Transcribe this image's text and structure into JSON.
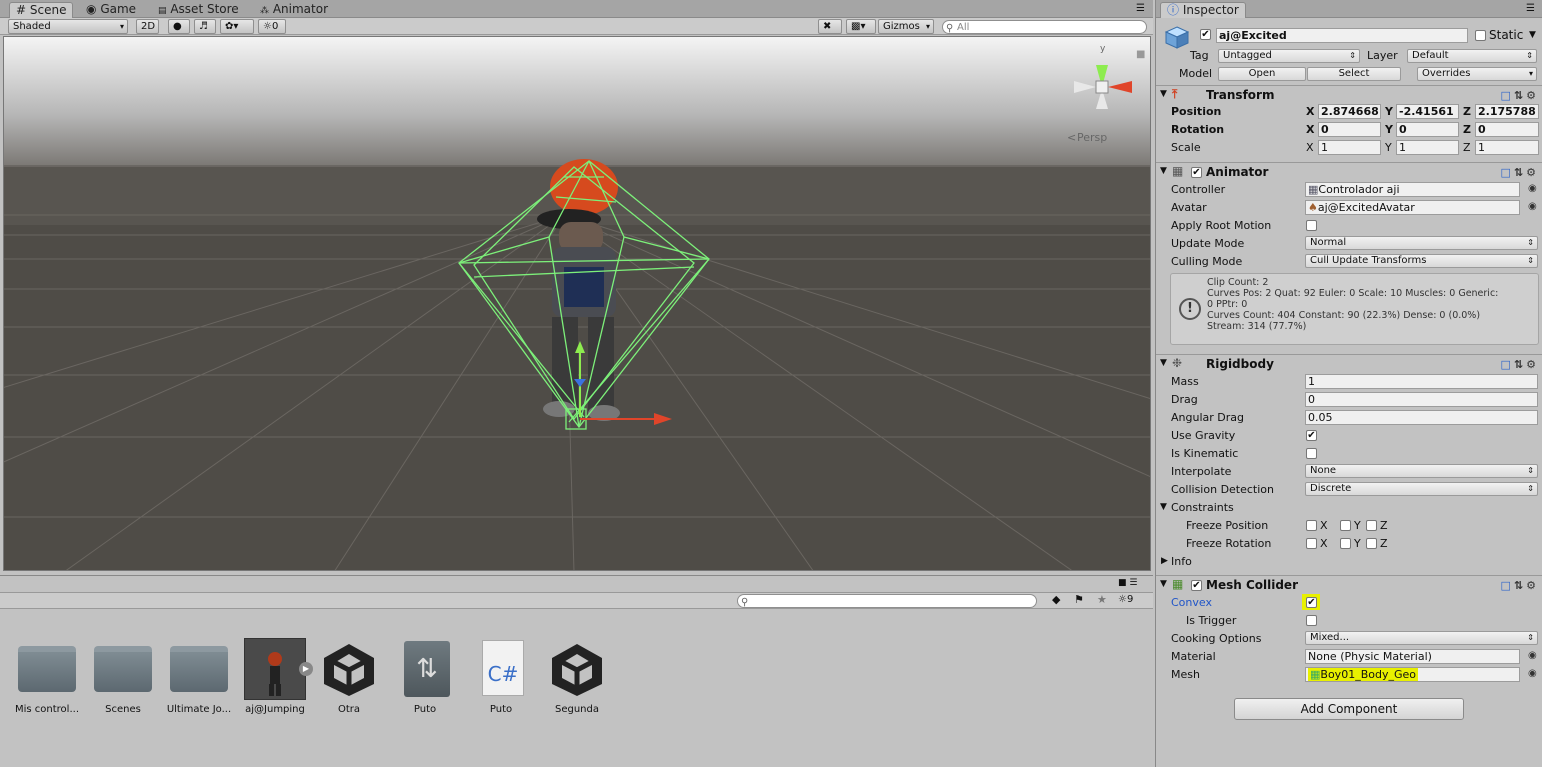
{
  "scene_tabs": [
    {
      "label": "Scene",
      "icon": "#"
    },
    {
      "label": "Game",
      "icon": "◉"
    },
    {
      "label": "Asset Store",
      "icon": "🛍"
    },
    {
      "label": "Animator",
      "icon": "⁂"
    }
  ],
  "scene_toolbar": {
    "shading": "Shaded",
    "mode_2d": "2D",
    "hidden_count": "0",
    "gizmos": "Gizmos",
    "search_placeholder": "All"
  },
  "viewport": {
    "projection": "Persp",
    "axis_y": "y"
  },
  "project": {
    "hidden_count": "9",
    "assets": [
      {
        "label": "Mis control...",
        "type": "folder"
      },
      {
        "label": "Scenes",
        "type": "folder"
      },
      {
        "label": "Ultimate Jo...",
        "type": "folder"
      },
      {
        "label": "aj@Jumping",
        "type": "model"
      },
      {
        "label": "Otra",
        "type": "unity"
      },
      {
        "label": "Puto",
        "type": "animator"
      },
      {
        "label": "Puto",
        "type": "csharp",
        "glyph": "C#"
      },
      {
        "label": "Segunda",
        "type": "unity"
      }
    ]
  },
  "inspector": {
    "tab": "Inspector",
    "object": {
      "name": "aj@Excited",
      "static_label": "Static",
      "tag_label": "Tag",
      "tag": "Untagged",
      "layer_label": "Layer",
      "layer": "Default",
      "model_label": "Model",
      "open": "Open",
      "select": "Select",
      "overrides": "Overrides"
    },
    "transform": {
      "title": "Transform",
      "position_label": "Position",
      "rotation_label": "Rotation",
      "scale_label": "Scale",
      "position": {
        "x": "2.874668",
        "y": "-2.41561",
        "z": "2.175788"
      },
      "rotation": {
        "x": "0",
        "y": "0",
        "z": "0"
      },
      "scale": {
        "x": "1",
        "y": "1",
        "z": "1"
      }
    },
    "animator": {
      "title": "Animator",
      "controller_label": "Controller",
      "controller": "Controlador aji",
      "avatar_label": "Avatar",
      "avatar": "aj@ExcitedAvatar",
      "apply_root_label": "Apply Root Motion",
      "update_label": "Update Mode",
      "update": "Normal",
      "culling_label": "Culling Mode",
      "culling": "Cull Update Transforms",
      "info_lines": [
        "Clip Count: 2",
        "Curves Pos: 2 Quat: 92 Euler: 0 Scale: 10 Muscles: 0 Generic:",
        "0 PPtr: 0",
        "Curves Count: 404 Constant: 90 (22.3%) Dense: 0 (0.0%)",
        "Stream: 314 (77.7%)"
      ]
    },
    "rigidbody": {
      "title": "Rigidbody",
      "mass_label": "Mass",
      "mass": "1",
      "drag_label": "Drag",
      "drag": "0",
      "angular_label": "Angular Drag",
      "angular": "0.05",
      "gravity_label": "Use Gravity",
      "kinematic_label": "Is Kinematic",
      "interpolate_label": "Interpolate",
      "interpolate": "None",
      "collision_label": "Collision Detection",
      "collision": "Discrete",
      "constraints_label": "Constraints",
      "freeze_pos_label": "Freeze Position",
      "freeze_rot_label": "Freeze Rotation",
      "x": "X",
      "y": "Y",
      "z": "Z",
      "info_label": "Info"
    },
    "mesh_collider": {
      "title": "Mesh Collider",
      "convex_label": "Convex",
      "trigger_label": "Is Trigger",
      "cooking_label": "Cooking Options",
      "cooking": "Mixed...",
      "material_label": "Material",
      "material": "None (Physic Material)",
      "mesh_label": "Mesh",
      "mesh": "Boy01_Body_Geo"
    },
    "add_component": "Add Component"
  },
  "colors": {
    "accent_blue": "#2055c8",
    "highlight": "#e8f000",
    "ground": "#4e4b46",
    "sky": "#f3f3f3"
  }
}
